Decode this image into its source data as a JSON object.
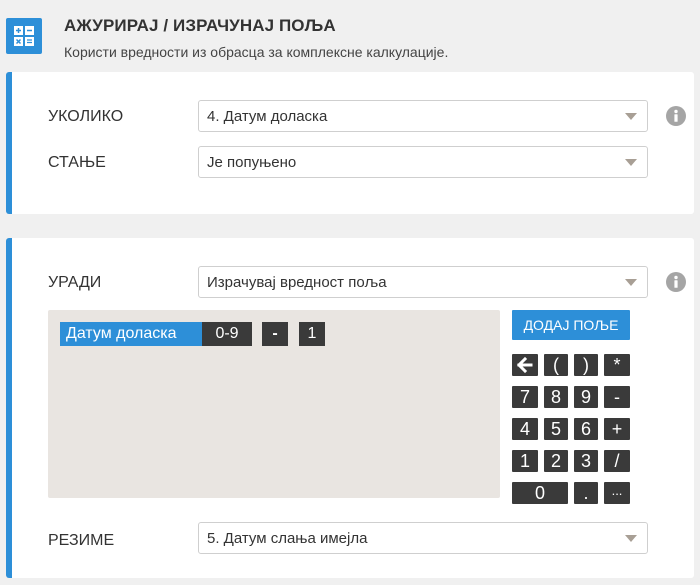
{
  "header": {
    "title": "АЖУРИРАЈ / ИЗРАЧУНАЈ ПОЉА",
    "subtitle": "Користи вредности из обрасца за комплексне калкулације.",
    "icon": "calculator-icon"
  },
  "condition": {
    "if_label": "УКОЛИКО",
    "if_value": "4. Датум доласка",
    "state_label": "СТАЊЕ",
    "state_value": "Је попуњено"
  },
  "action": {
    "do_label": "УРАДИ",
    "do_value": "Израчувај вредност поља",
    "add_field_label": "ДОДАЈ ПОЉЕ",
    "result_label": "РЕЗИМЕ",
    "result_value": "5. Датум слања имејла"
  },
  "formula": {
    "field_token": "Датум доласка",
    "range_token": "0-9",
    "op_token": "-",
    "num_token": "1"
  },
  "keypad": {
    "back": "backspace-arrow-icon",
    "lparen": "(",
    "rparen": ")",
    "mul": "*",
    "k7": "7",
    "k8": "8",
    "k9": "9",
    "minus": "-",
    "k4": "4",
    "k5": "5",
    "k6": "6",
    "plus": "+",
    "k1": "1",
    "k2": "2",
    "k3": "3",
    "div": "/",
    "k0": "0",
    "dot": ".",
    "more": "..."
  },
  "colors": {
    "accent": "#2d8fd8",
    "token_dark": "#3a3a3a",
    "formula_bg": "#e9e5e1",
    "page_bg": "#f0f0f0"
  }
}
